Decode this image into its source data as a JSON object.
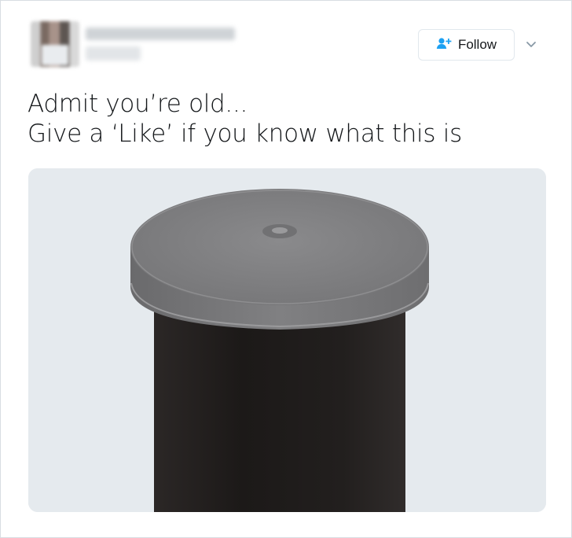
{
  "tweet": {
    "follow_label": "Follow",
    "text_line1": "Admit you’re old...",
    "text_line2": "Give a ‘Like’ if you know what this is"
  },
  "icons": {
    "follow": "add-user-icon",
    "menu": "chevron-down-icon"
  },
  "colors": {
    "accent": "#1da1f2",
    "media_background": "#e5eaee",
    "canister_body": "#1f1c1b",
    "canister_lid": "#7e7e80"
  }
}
